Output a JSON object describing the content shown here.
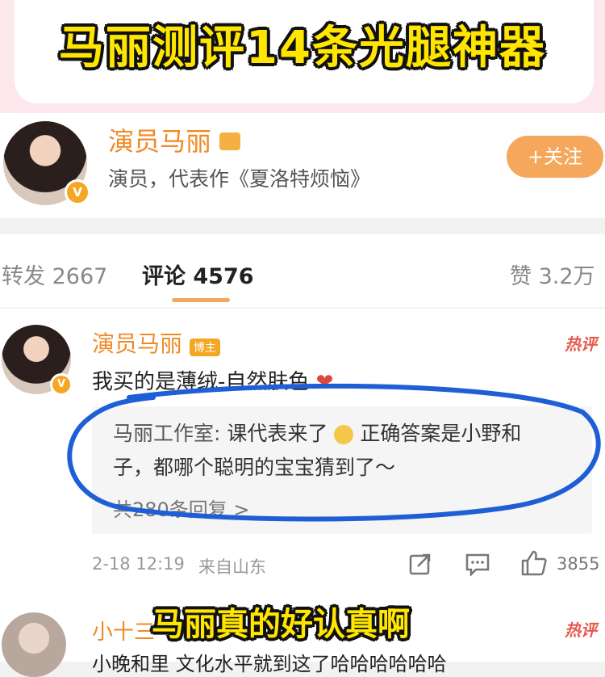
{
  "banner_title": "马丽测评14条光腿神器",
  "profile": {
    "name": "演员马丽",
    "description": "演员，代表作《夏洛特烦恼》",
    "follow_label": "+关注",
    "verified_badge": "V"
  },
  "tabs": {
    "repost": "转发 2667",
    "comments": "评论 4576",
    "likes": "赞 3.2万"
  },
  "comment": {
    "author": "演员马丽",
    "author_tag": "博主",
    "hot_label": "热评",
    "text": "我买的是薄绒-自然肤色",
    "reply_author": "马丽工作室:",
    "reply_line1": "课代表来了",
    "reply_line1_tail": "正确答案是小野和",
    "reply_line2": "子，都哪个聪明的宝宝猜到了～",
    "reply_count": "共280条回复 >",
    "time": "2-18 12:19",
    "source": "来自山东",
    "like_count": "3855"
  },
  "comment2": {
    "author": "小十三",
    "hot_label": "热评",
    "text": "小晚和里 文化水平就到这了哈哈哈哈哈哈"
  },
  "caption": "马丽真的好认真啊",
  "colors": {
    "accent_orange": "#f5a85c",
    "circle_annotation": "#1f5fd6",
    "caption_yellow": "#ffe600"
  }
}
